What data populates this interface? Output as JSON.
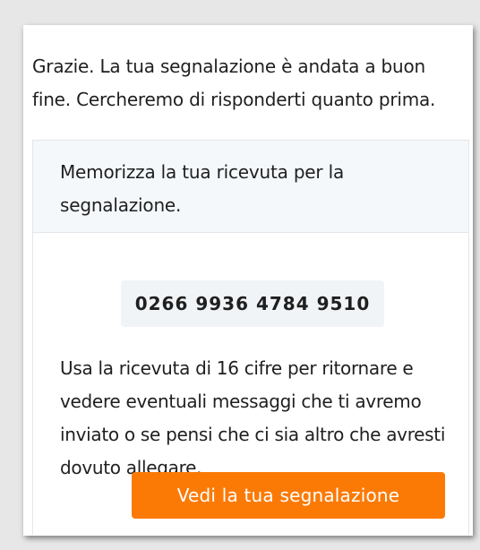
{
  "confirmation": {
    "message": "Grazie. La tua segnalazione è andata a buon fine. Cercheremo di risponderti quanto prima."
  },
  "receipt": {
    "header_text": "Memorizza la tua ricevuta per la segnalazione.",
    "code": "0266 9936 4784 9510",
    "description": "Usa la ricevuta di 16 cifre per ritornare e vedere eventuali messaggi che ti avremo inviato o se pensi che ci sia altro che avresti dovuto allegare.",
    "view_button_label": "Vedi la tua segnalazione"
  },
  "colors": {
    "accent": "#fb7a06",
    "panel_background": "#f5f8fb",
    "page_background": "#e7e7e7"
  }
}
